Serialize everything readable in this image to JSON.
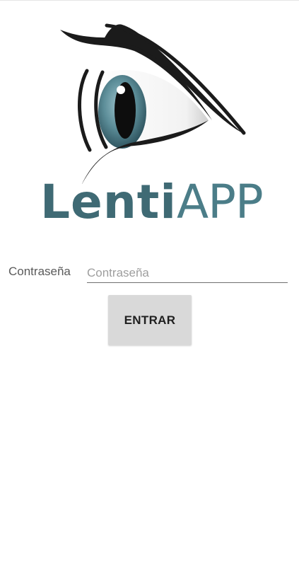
{
  "logo": {
    "word_bold": "Lenti",
    "word_light": "APP",
    "colors": {
      "eyelash": "#1b1b1b",
      "iris": "#4f7f8a",
      "wordmark": "#3f6a74"
    }
  },
  "login": {
    "password_label": "Contraseña",
    "password_placeholder": "Contraseña",
    "password_value": "",
    "submit_label": "ENTRAR"
  },
  "colors": {
    "background": "#ffffff",
    "button_bg": "#d9d9d9",
    "underline": "#6f6f6f"
  }
}
